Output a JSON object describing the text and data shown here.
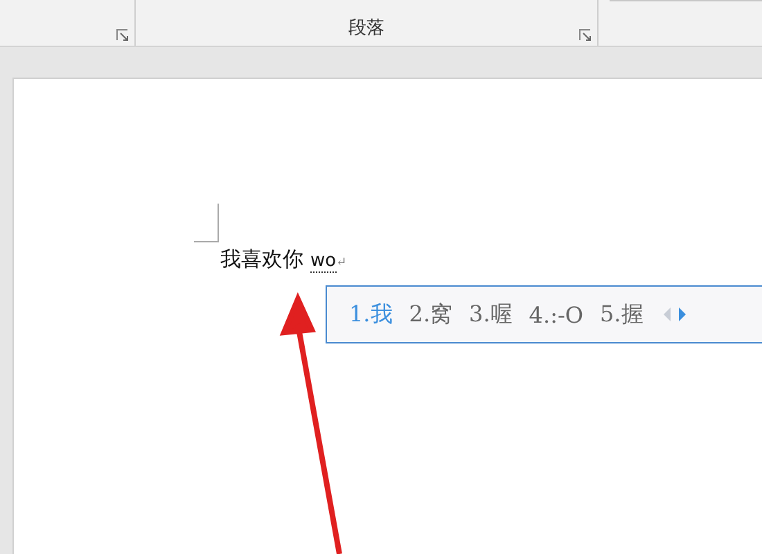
{
  "ribbon": {
    "group_label": "段落"
  },
  "document": {
    "text": "我喜欢你",
    "composition": "wo",
    "paragraph_mark": "↵"
  },
  "ime": {
    "candidates": [
      {
        "label": "1.我",
        "selected": true
      },
      {
        "label": "2.窝",
        "selected": false
      },
      {
        "label": "3.喔",
        "selected": false
      },
      {
        "label": "4.:-O",
        "selected": false
      },
      {
        "label": "5.握",
        "selected": false
      }
    ],
    "prev_disabled": true,
    "next_disabled": false
  }
}
